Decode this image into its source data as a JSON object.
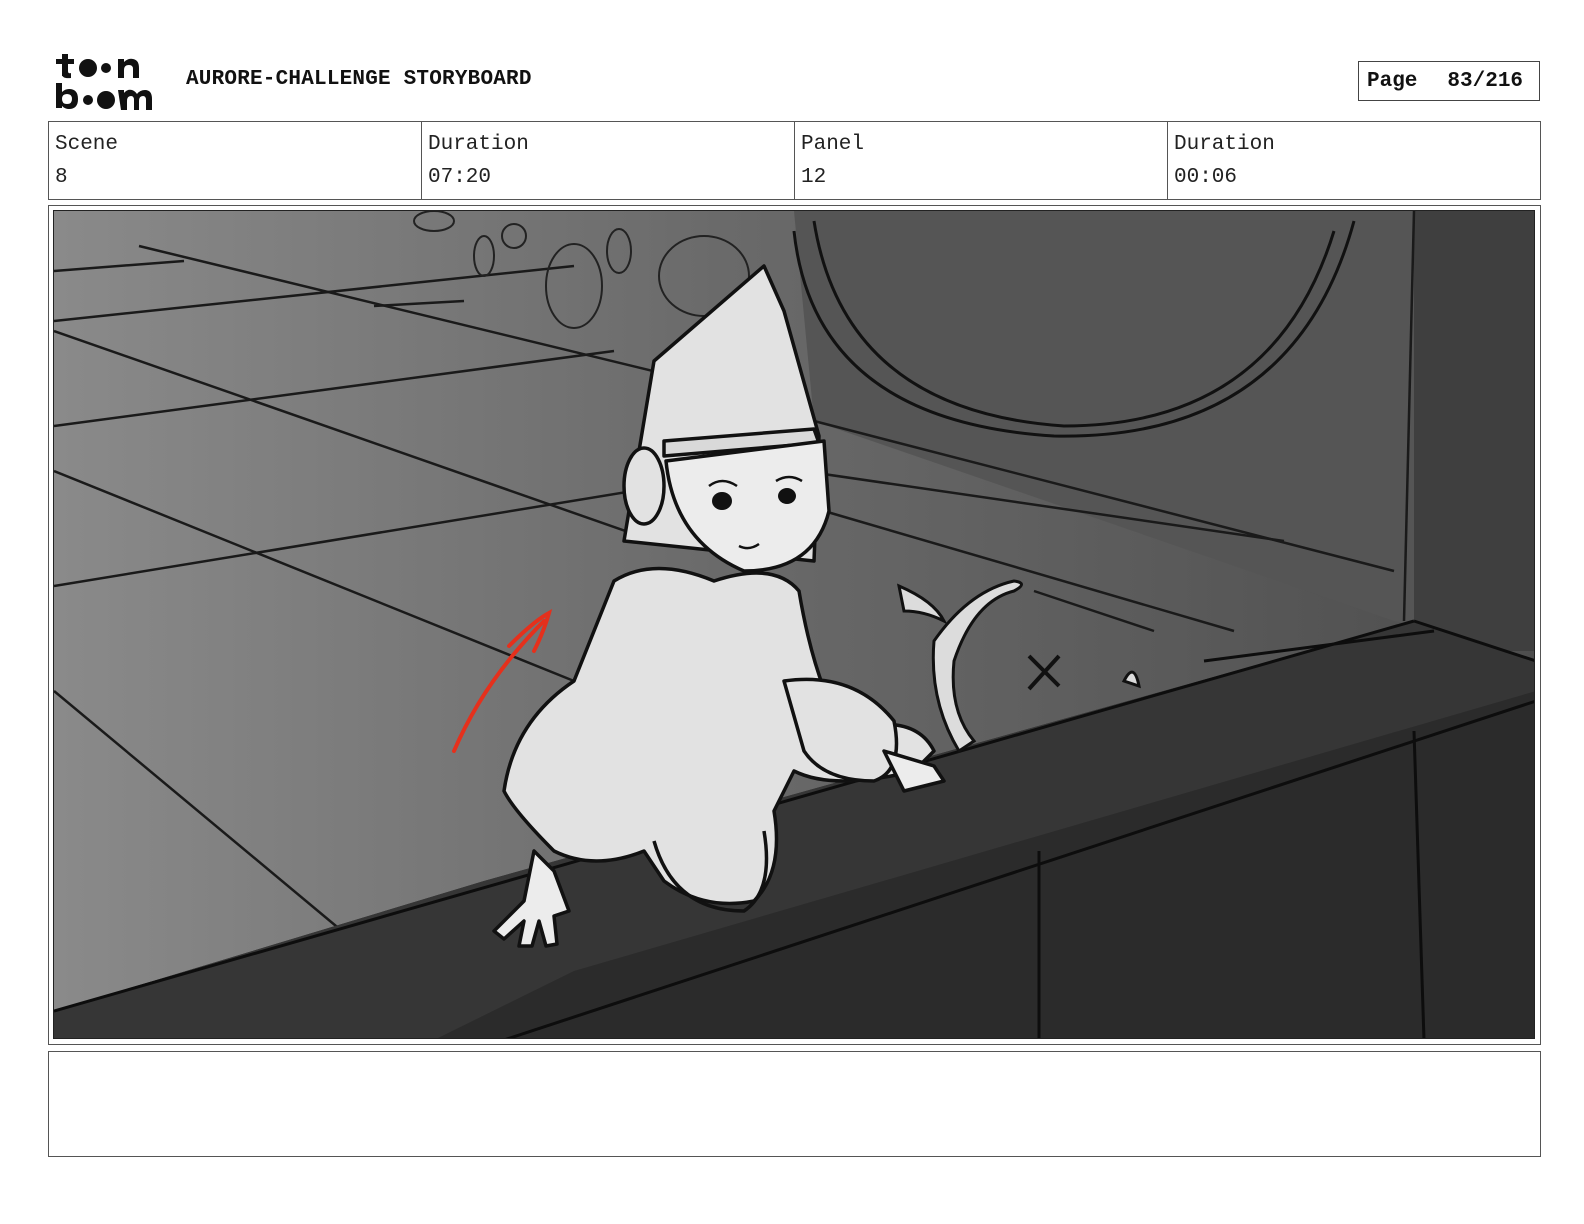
{
  "header": {
    "logo_line1": "t••n",
    "logo_line2": "b••m",
    "title": "AURORE-CHALLENGE STORYBOARD",
    "page_label": "Page",
    "page_value": "83/216"
  },
  "info": [
    {
      "label": "Scene",
      "value": "8"
    },
    {
      "label": "Duration",
      "value": "07:20"
    },
    {
      "label": "Panel",
      "value": "12"
    },
    {
      "label": "Duration",
      "value": "00:06"
    }
  ],
  "panel": {
    "description": "",
    "accent_color": "#e5301c"
  },
  "notes": ""
}
